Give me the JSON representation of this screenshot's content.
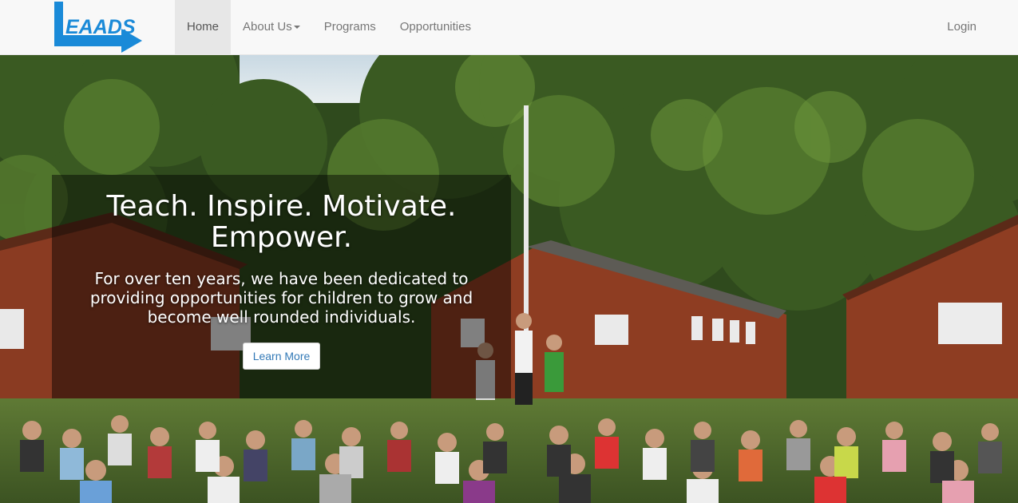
{
  "brand": {
    "logo_text": "EAADS",
    "accent": "#1a8ad8"
  },
  "nav": {
    "home": "Home",
    "about": "About Us",
    "programs": "Programs",
    "opportunities": "Opportunities",
    "login": "Login"
  },
  "hero": {
    "headline_line1": "Teach. Inspire. Motivate.",
    "headline_line2": "Empower.",
    "subtext": "For over ten years, we have been dedicated to providing opportunities for children to grow and become well rounded individuals.",
    "cta": "Learn More",
    "image": "summer-camp-group-photo"
  },
  "colors": {
    "navbar_bg": "#f8f8f8",
    "active_bg": "#e7e7e7",
    "link": "#337ab7"
  }
}
